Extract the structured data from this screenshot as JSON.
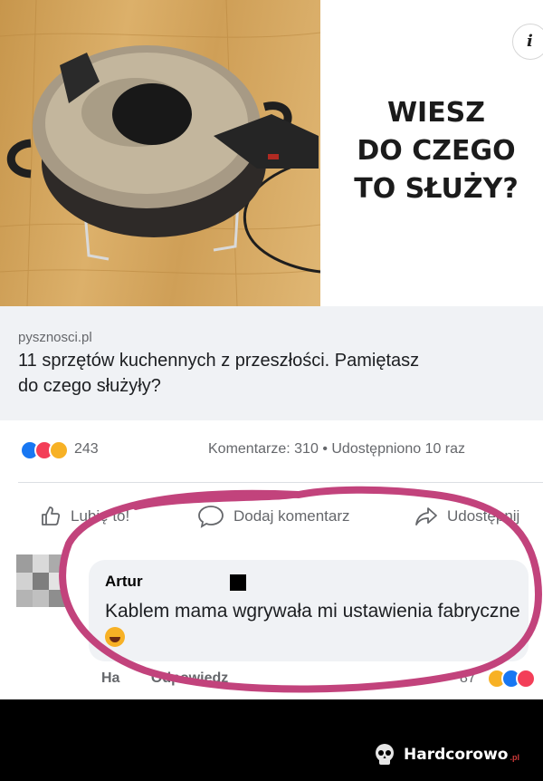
{
  "hero": {
    "info_label": "i",
    "title_lines": [
      "WIESZ",
      "DO CZEGO",
      "TO SŁUŻY?"
    ]
  },
  "link": {
    "domain": "pysznosci.pl",
    "headline_lines": [
      "11 sprzętów kuchennych z przeszłości. Pamiętasz",
      "do czego służyły?"
    ]
  },
  "stats": {
    "reaction_count": "243",
    "reactions": [
      "like-icon",
      "love-icon",
      "haha-icon"
    ],
    "comments_text": "Komentarze: 310",
    "separator": "•",
    "shares_text": "Udostępniono 10 raz"
  },
  "actions": {
    "like_label": "Lubię to!",
    "comment_label": "Dodaj komentarz",
    "share_label": "Udostępnij"
  },
  "comment": {
    "author": "Artur",
    "text": "Kablem mama wgrywała mi ustawienia fabryczne",
    "like_action": "Ha",
    "reply_action": "Odpowiedz",
    "reaction_count": "87"
  },
  "watermark": {
    "brand": "Hardcorowo",
    "suffix": ".pl"
  },
  "colors": {
    "highlight": "#c2437c",
    "like": "#1877f2",
    "love": "#f33e58",
    "haha": "#f7b125"
  }
}
